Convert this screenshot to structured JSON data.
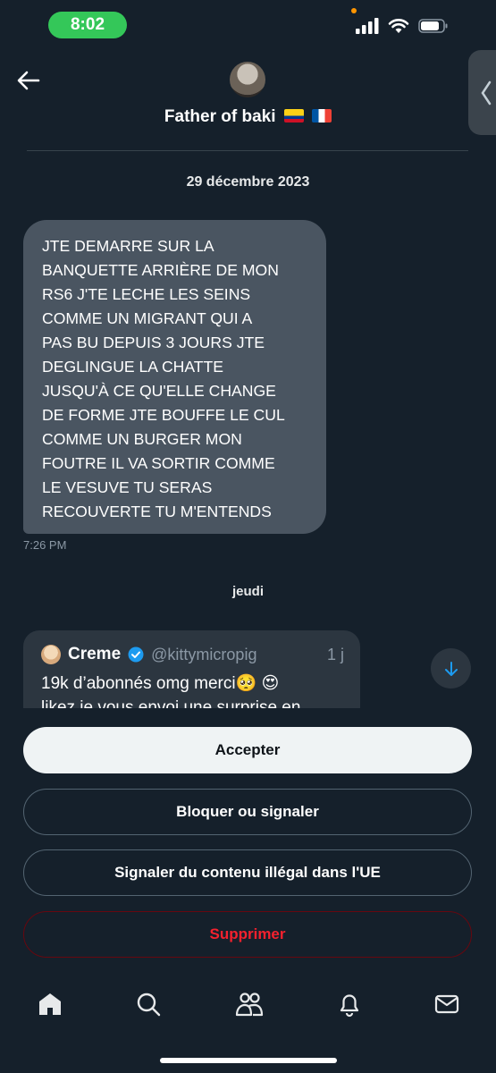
{
  "status_bar": {
    "time": "8:02"
  },
  "header": {
    "contact_name": "Father of baki",
    "icons": [
      "back-arrow-icon",
      "avatar",
      "colombia-flag-icon",
      "france-flag-icon",
      "chevron-left-icon"
    ]
  },
  "conversation": {
    "date_separator": "29 décembre 2023",
    "message": {
      "text": "JTE DEMARRE SUR LA\nBANQUETTE ARRIÈRE DE MON\nRS6 J'TE LECHE LES SEINS\nCOMME UN MIGRANT QUI A\nPAS BU DEPUIS 3 JOURS JTE\nDEGLINGUE LA CHATTE\nJUSQU'À CE QU'ELLE CHANGE\nDE FORME JTE BOUFFE LE CUL\nCOMME UN BURGER MON\nFOUTRE IL VA SORTIR COMME\nLE VESUVE TU SERAS\nRECOUVERTE TU M'ENTENDS",
      "time": "7:26 PM"
    },
    "day_separator": "jeudi",
    "shared_post": {
      "name": "Creme",
      "handle": "@kittymicropig",
      "age": "1 j",
      "text": "19k d’abonnés omg merci🥺 😍\nlikez je vous envoi une surprise en"
    }
  },
  "actions": {
    "accept": "Accepter",
    "block_report": "Bloquer ou signaler",
    "report_illegal": "Signaler du contenu illégal dans l'UE",
    "delete": "Supprimer"
  },
  "tab_bar": [
    "home-icon",
    "search-icon",
    "communities-icon",
    "notifications-icon",
    "messages-icon"
  ],
  "colors": {
    "background": "#15202b",
    "bubble": "#4a5561",
    "accent_blue": "#1d9bf0",
    "danger": "#f4212e",
    "status_green": "#34c759"
  }
}
